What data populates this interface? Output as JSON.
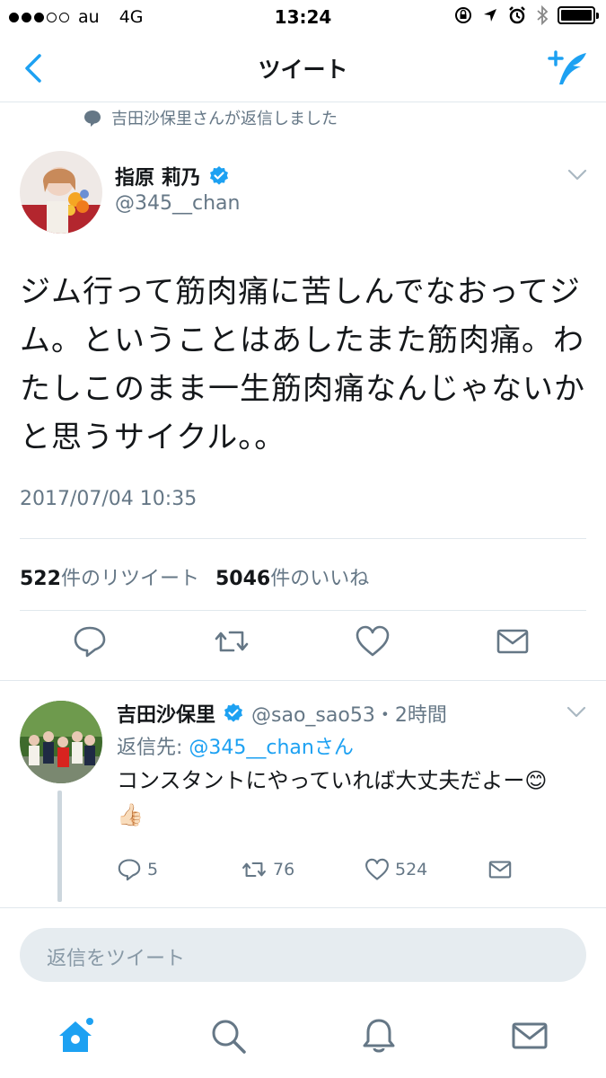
{
  "status_bar": {
    "carrier": "au",
    "network": "4G",
    "time": "13:24"
  },
  "nav": {
    "title": "ツイート"
  },
  "context": {
    "text": "吉田沙保里さんが返信しました"
  },
  "tweet": {
    "author_name": "指原 莉乃",
    "author_handle": "@345__chan",
    "text": "ジム行って筋肉痛に苦しんでなおってジム。ということはあしたまた筋肉痛。わたしこのまま一生筋肉痛なんじゃないかと思うサイクル。。",
    "timestamp": "2017/07/04 10:35",
    "retweet_count": "522",
    "retweet_label": "件のリツイート",
    "like_count": "5046",
    "like_label": "件のいいね"
  },
  "reply": {
    "author_name": "吉田沙保里",
    "meta": "@sao_sao53・2時間",
    "reply_to_label": "返信先: ",
    "reply_to_handle": "@345__chanさん",
    "text": "コンスタントにやっていれば大丈夫だよー😊👍🏻",
    "reply_count": "5",
    "retweet_count": "76",
    "like_count": "524"
  },
  "compose": {
    "placeholder": "返信をツイート"
  },
  "colors": {
    "accent": "#1da1f2",
    "secondary_text": "#657786",
    "divider": "#e1e8ed"
  }
}
